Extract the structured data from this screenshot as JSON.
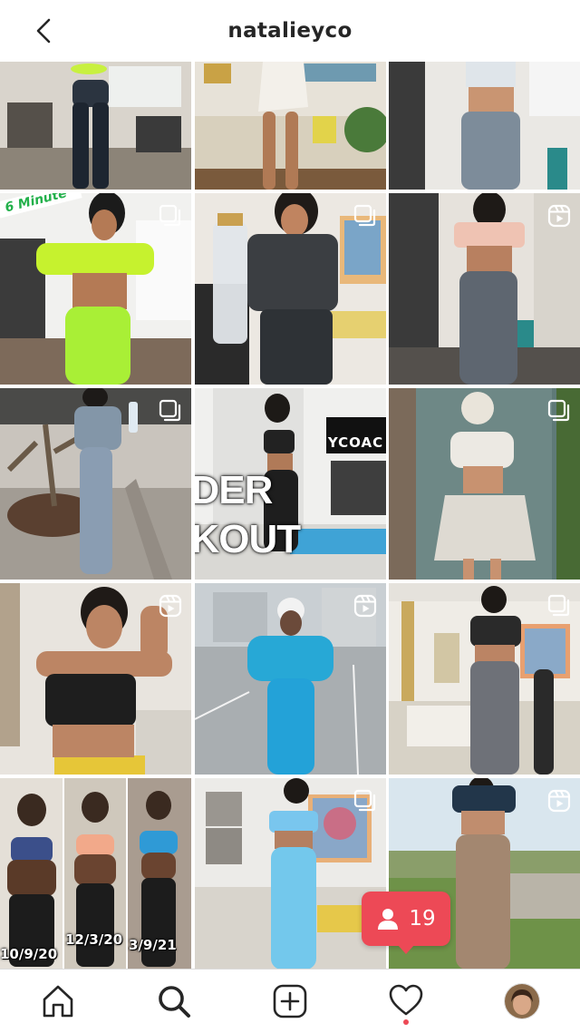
{
  "header": {
    "username": "natalieyco"
  },
  "tiles": [
    {
      "type": "post"
    },
    {
      "type": "post"
    },
    {
      "type": "post"
    },
    {
      "type": "carousel",
      "overlay_text": "6 Minute"
    },
    {
      "type": "carousel"
    },
    {
      "type": "reel"
    },
    {
      "type": "carousel"
    },
    {
      "type": "post",
      "overlay_text_line1": "DER",
      "overlay_text_line2": "KOUT",
      "brand_text": "YCOAC"
    },
    {
      "type": "carousel"
    },
    {
      "type": "reel"
    },
    {
      "type": "reel"
    },
    {
      "type": "carousel"
    },
    {
      "type": "post",
      "dates": [
        "10/9/20",
        "12/3/20",
        "3/9/21"
      ]
    },
    {
      "type": "carousel"
    },
    {
      "type": "reel"
    }
  ],
  "notification": {
    "follower_count": "19",
    "color": "#ed4956"
  },
  "tabbar": {
    "items": [
      "home-icon",
      "search-icon",
      "new-post-icon",
      "activity-heart-icon",
      "profile-avatar"
    ]
  }
}
